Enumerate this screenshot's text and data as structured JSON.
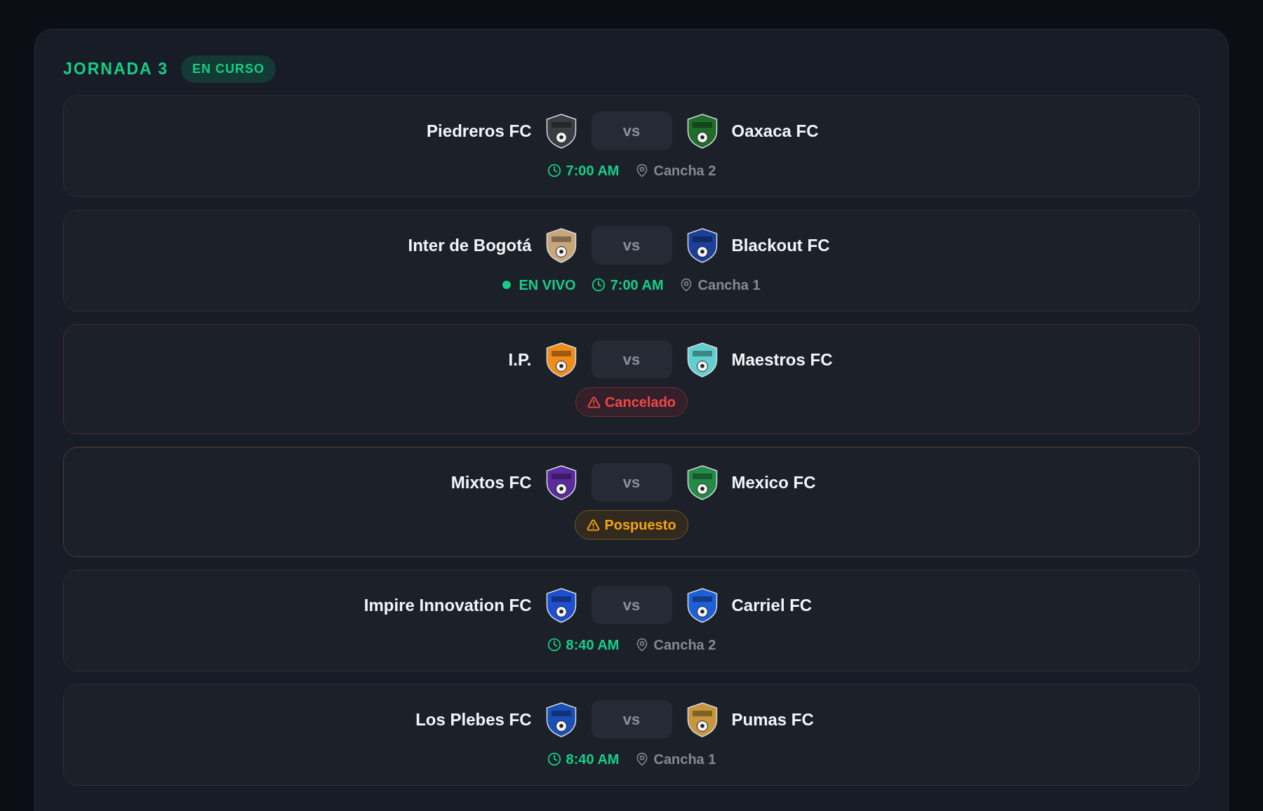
{
  "matchday": {
    "title": "JORNADA 3",
    "status_badge": "EN CURSO"
  },
  "matches": [
    {
      "kind": "scheduled",
      "home": {
        "name": "Piedreros FC",
        "color": "#3a3d42"
      },
      "vs": "vs",
      "away": {
        "name": "Oaxaca FC",
        "color": "#1f6b2a"
      },
      "time": "7:00 AM",
      "venue": "Cancha 2"
    },
    {
      "kind": "live",
      "live_label": "EN VIVO",
      "home": {
        "name": "Inter de Bogotá",
        "color": "#c9a57a"
      },
      "vs": "vs",
      "away": {
        "name": "Blackout FC",
        "color": "#1b3f9a"
      },
      "time": "7:00 AM",
      "venue": "Cancha 1"
    },
    {
      "kind": "cancelled",
      "home": {
        "name": "I.P.",
        "color": "#f08c1a"
      },
      "vs": "vs",
      "away": {
        "name": "Maestros FC",
        "color": "#5fcfd0"
      },
      "status_label": "Cancelado"
    },
    {
      "kind": "postponed",
      "home": {
        "name": "Mixtos FC",
        "color": "#5b2a9c"
      },
      "vs": "vs",
      "away": {
        "name": "Mexico FC",
        "color": "#238b45"
      },
      "status_label": "Pospuesto"
    },
    {
      "kind": "scheduled",
      "home": {
        "name": "Impire Innovation FC",
        "color": "#1e4fd0"
      },
      "vs": "vs",
      "away": {
        "name": "Carriel FC",
        "color": "#1d5fd6"
      },
      "time": "8:40 AM",
      "venue": "Cancha 2"
    },
    {
      "kind": "scheduled",
      "home": {
        "name": "Los Plebes FC",
        "color": "#1a4fb5"
      },
      "vs": "vs",
      "away": {
        "name": "Pumas FC",
        "color": "#c8963c"
      },
      "time": "8:40 AM",
      "venue": "Cancha 1"
    }
  ]
}
